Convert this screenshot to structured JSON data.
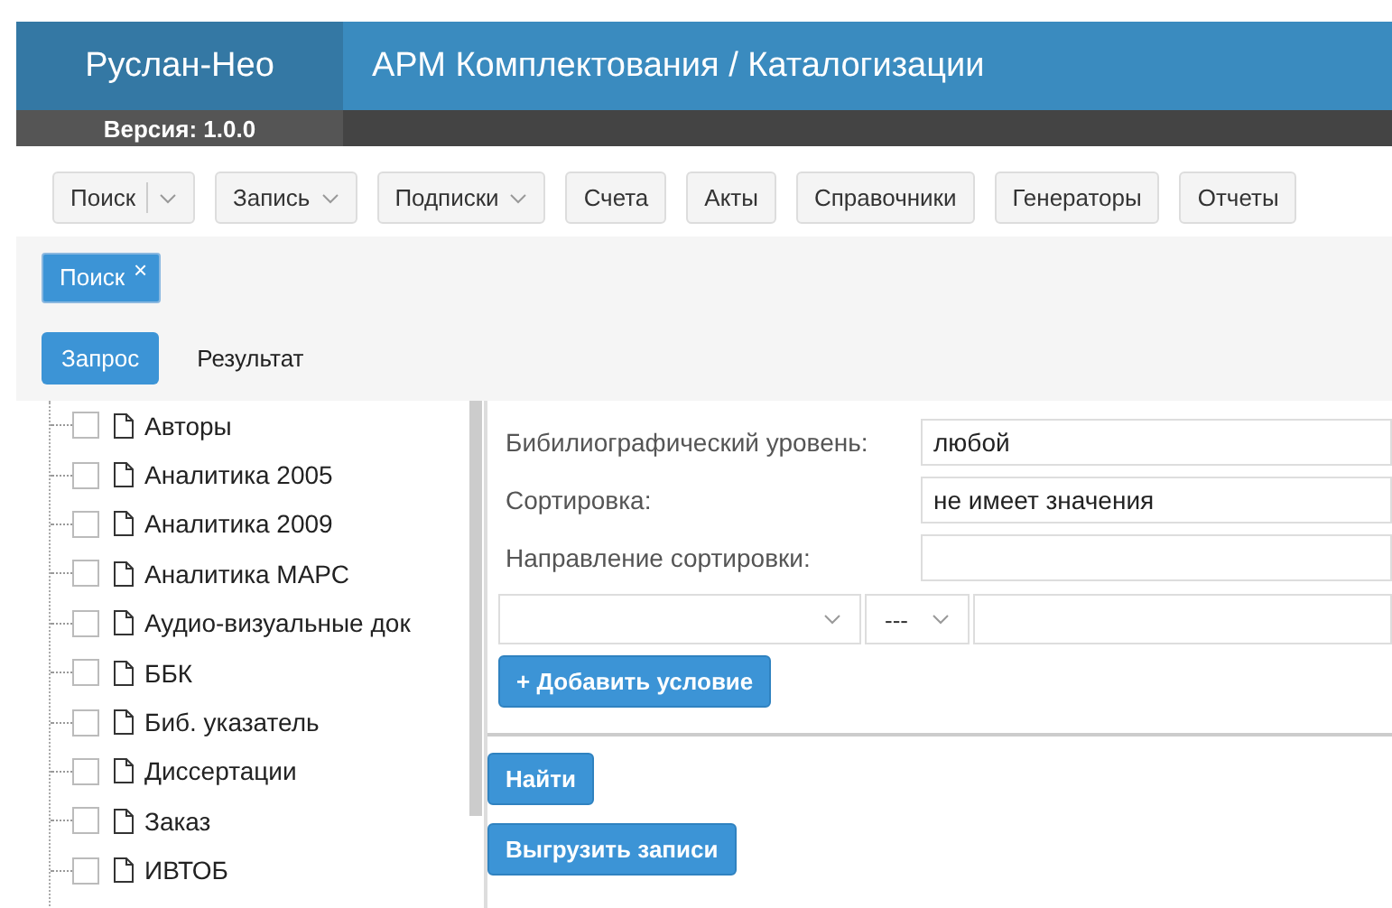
{
  "header": {
    "app_name": "Руслан-Нео",
    "title": "АРМ Комплектования / Каталогизации",
    "version": "Версия: 1.0.0"
  },
  "toolbar": [
    {
      "label": "Поиск",
      "kind": "split"
    },
    {
      "label": "Запись",
      "kind": "dropdown"
    },
    {
      "label": "Подписки",
      "kind": "dropdown"
    },
    {
      "label": "Счета",
      "kind": "plain"
    },
    {
      "label": "Акты",
      "kind": "plain"
    },
    {
      "label": "Справочники",
      "kind": "plain"
    },
    {
      "label": "Генераторы",
      "kind": "plain"
    },
    {
      "label": "Отчеты",
      "kind": "plain"
    }
  ],
  "open_tabs": [
    {
      "label": "Поиск",
      "close": "×",
      "selected": true
    }
  ],
  "view_tabs": [
    {
      "label": "Запрос",
      "selected": true
    },
    {
      "label": "Результат",
      "selected": false
    }
  ],
  "databases": [
    {
      "label": "Авторы",
      "checked": false
    },
    {
      "label": "Аналитика 2005",
      "checked": false
    },
    {
      "label": "Аналитика 2009",
      "checked": false
    },
    {
      "label": "Аналитика МАРС",
      "checked": false
    },
    {
      "label": "Аудио-визуальные док",
      "checked": false
    },
    {
      "label": "ББК",
      "checked": false
    },
    {
      "label": "Биб. указатель",
      "checked": false
    },
    {
      "label": "Диссертации",
      "checked": false
    },
    {
      "label": "Заказ",
      "checked": false
    },
    {
      "label": "ИВТОБ",
      "checked": false
    }
  ],
  "form": {
    "fields": [
      {
        "label": "Бибилиографический уровень:",
        "value": "любой"
      },
      {
        "label": "Сортировка:",
        "value": "не имеет значения"
      },
      {
        "label": "Направление сортировки:"
      }
    ],
    "condition": {
      "operator": "---"
    },
    "add_button": "+ Добавить условие"
  },
  "actions": [
    "Найти",
    "Выгрузить записи"
  ]
}
